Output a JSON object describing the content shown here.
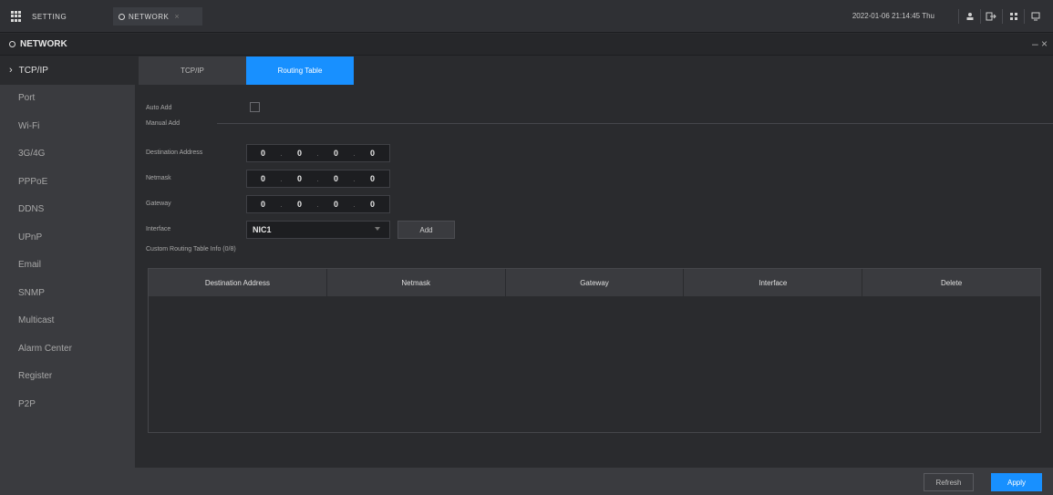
{
  "topbar": {
    "setting_tab": "SETTING",
    "network_tab": "NETWORK",
    "close_glyph": "×",
    "clock": "2022-01-06 21:14:45 Thu",
    "icons": [
      "user-icon",
      "logout-icon",
      "grid-menu-icon",
      "monitor-icon"
    ]
  },
  "header": {
    "title": "NETWORK",
    "window_controls": "– ×"
  },
  "sidebar": {
    "items": [
      {
        "label": "TCP/IP",
        "active": true
      },
      {
        "label": "Port"
      },
      {
        "label": "Wi-Fi"
      },
      {
        "label": "3G/4G"
      },
      {
        "label": "PPPoE"
      },
      {
        "label": "DDNS"
      },
      {
        "label": "UPnP"
      },
      {
        "label": "Email"
      },
      {
        "label": "SNMP"
      },
      {
        "label": "Multicast"
      },
      {
        "label": "Alarm Center"
      },
      {
        "label": "Register"
      },
      {
        "label": "P2P"
      }
    ]
  },
  "subtabs": {
    "tcpip": "TCP/IP",
    "routing": "Routing Table"
  },
  "form": {
    "auto_add_label": "Auto Add",
    "manual_add_label": "Manual Add",
    "destination_label": "Destination Address",
    "netmask_label": "Netmask",
    "gateway_label": "Gateway",
    "interface_label": "Interface",
    "destination": [
      "0",
      "0",
      "0",
      "0"
    ],
    "netmask": [
      "0",
      "0",
      "0",
      "0"
    ],
    "gateway": [
      "0",
      "0",
      "0",
      "0"
    ],
    "interface_value": "NIC1",
    "add_button": "Add",
    "custom_info": "Custom Routing Table Info (0/8)"
  },
  "table": {
    "headers": [
      "Destination Address",
      "Netmask",
      "Gateway",
      "Interface",
      "Delete"
    ]
  },
  "footer": {
    "refresh": "Refresh",
    "apply": "Apply"
  },
  "colors": {
    "accent": "#1890ff",
    "background": "#2a2b2e",
    "sidebar": "#3a3b3f"
  }
}
